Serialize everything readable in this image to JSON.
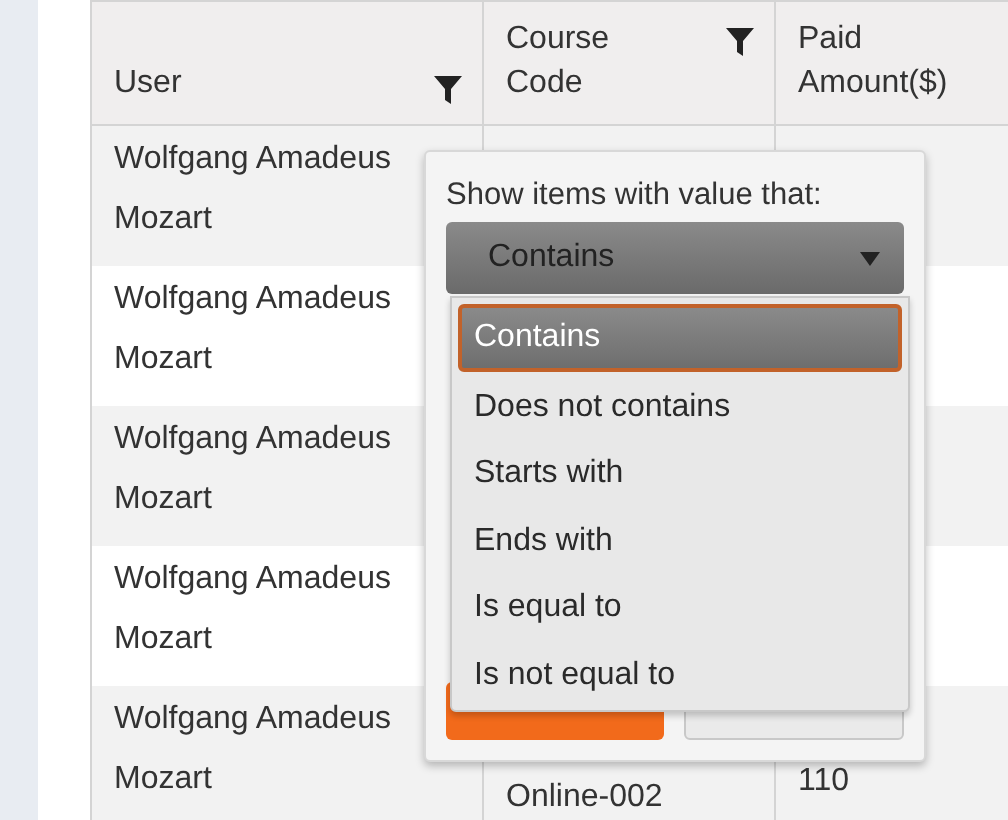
{
  "table": {
    "columns": [
      {
        "label": "User",
        "filterable": true
      },
      {
        "label": "Course Code",
        "filterable": true
      },
      {
        "label": "Paid Amount($)",
        "filterable": false
      }
    ],
    "rows": [
      {
        "user": "Wolfgang Amadeus Mozart"
      },
      {
        "user": "Wolfgang Amadeus Mozart"
      },
      {
        "user": "Wolfgang Amadeus Mozart"
      },
      {
        "user": "Wolfgang Amadeus Mozart"
      },
      {
        "user": "Wolfgang Amadeus Mozart",
        "course_code": "Online-002",
        "paid_amount": "110"
      }
    ]
  },
  "filter_popup": {
    "label": "Show items with value that:",
    "select": {
      "value": "Contains"
    },
    "options": [
      {
        "label": "Contains",
        "selected": true
      },
      {
        "label": "Does not contains",
        "selected": false
      },
      {
        "label": "Starts with",
        "selected": false
      },
      {
        "label": "Ends with",
        "selected": false
      },
      {
        "label": "Is equal to",
        "selected": false
      },
      {
        "label": "Is not equal to",
        "selected": false
      }
    ],
    "buttons": [
      {
        "kind": "primary"
      },
      {
        "kind": "secondary"
      }
    ]
  }
}
